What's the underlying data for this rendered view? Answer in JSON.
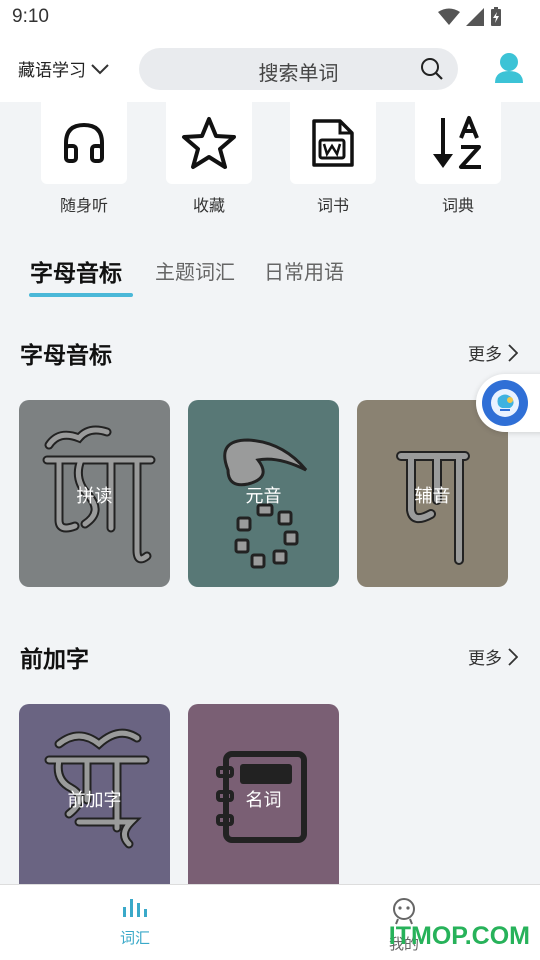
{
  "status_bar": {
    "time": "9:10"
  },
  "header": {
    "language": "藏语学习",
    "search_placeholder": "搜索单词"
  },
  "quick_actions": [
    {
      "label": "随身听",
      "icon": "headphones-icon"
    },
    {
      "label": "收藏",
      "icon": "star-icon"
    },
    {
      "label": "词书",
      "icon": "word-document-icon"
    },
    {
      "label": "词典",
      "icon": "sort-az-icon"
    }
  ],
  "tabs": [
    {
      "label": "字母音标",
      "active": true
    },
    {
      "label": "主题词汇",
      "active": false
    },
    {
      "label": "日常用语",
      "active": false
    }
  ],
  "sections": [
    {
      "title": "字母音标",
      "more": "更多",
      "cards": [
        {
          "label": "拼读",
          "color": "#7d8182",
          "icon": "tibetan-letter-icon"
        },
        {
          "label": "元音",
          "color": "#587876",
          "icon": "vowel-mark-icon"
        },
        {
          "label": "辅音",
          "color": "#8a8272",
          "icon": "tibetan-consonant-icon"
        }
      ]
    },
    {
      "title": "前加字",
      "more": "更多",
      "cards": [
        {
          "label": "前加字",
          "color": "#6a6482",
          "icon": "tibetan-prefix-icon"
        },
        {
          "label": "名词",
          "color": "#7a5f74",
          "icon": "notebook-icon"
        }
      ]
    }
  ],
  "bottom_nav": [
    {
      "label": "词汇",
      "icon": "bar-chart-icon",
      "active": true,
      "color": "#3aa9c9"
    },
    {
      "label": "我的",
      "icon": "robot-face-icon",
      "active": false,
      "color": "#666666"
    }
  ],
  "watermark": "ITMOP.COM",
  "colors": {
    "accent": "#4bb8d8",
    "profile": "#3cc3d6"
  }
}
